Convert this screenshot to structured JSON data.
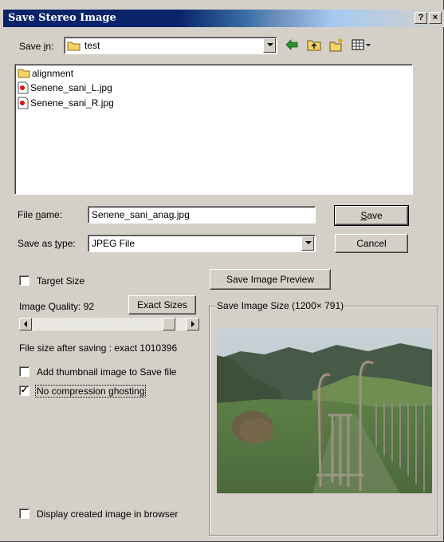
{
  "window": {
    "title": "Save Stereo Image",
    "help_button": "?",
    "close_button": "×"
  },
  "save_in": {
    "label_pre": "Save ",
    "label_key": "i",
    "label_post": "n:",
    "value": "test"
  },
  "toolbar": {
    "icons": [
      "back-arrow-icon",
      "up-folder-icon",
      "new-folder-icon",
      "view-menu-icon"
    ]
  },
  "files": [
    {
      "name": "alignment",
      "type": "folder"
    },
    {
      "name": "Senene_sani_L.jpg",
      "type": "image"
    },
    {
      "name": "Senene_sani_R.jpg",
      "type": "image"
    }
  ],
  "file_name": {
    "label_pre": "File ",
    "label_key": "n",
    "label_post": "ame:",
    "value": "Senene_sani_anag.jpg"
  },
  "save_as_type": {
    "label_pre": "Save as ",
    "label_key": "t",
    "label_post": "ype:",
    "value": "JPEG File"
  },
  "buttons": {
    "save_key": "S",
    "save_rest": "ave",
    "cancel": "Cancel",
    "save_preview": "Save Image Preview",
    "exact_sizes": "Exact Sizes"
  },
  "options": {
    "target_size": {
      "label": "Target Size",
      "checked": false
    },
    "quality_label": "Image Quality:",
    "quality_value": "92",
    "quality_slider_fraction": 0.92,
    "file_size_text": "File size after saving : exact 1010396",
    "add_thumbnail": {
      "label": "Add thumbnail image to Save file",
      "checked": false
    },
    "no_compression_ghosting": {
      "label": "No compression ghosting",
      "checked": true
    },
    "display_in_browser": {
      "label": "Display created image in browser",
      "checked": false
    }
  },
  "preview_group": {
    "title": "Save Image Size (1200",
    "times": "×",
    "title_end": " 791)"
  },
  "colors": {
    "dialog_bg": "#d4d0c8",
    "title_blue": "#0a246a"
  }
}
